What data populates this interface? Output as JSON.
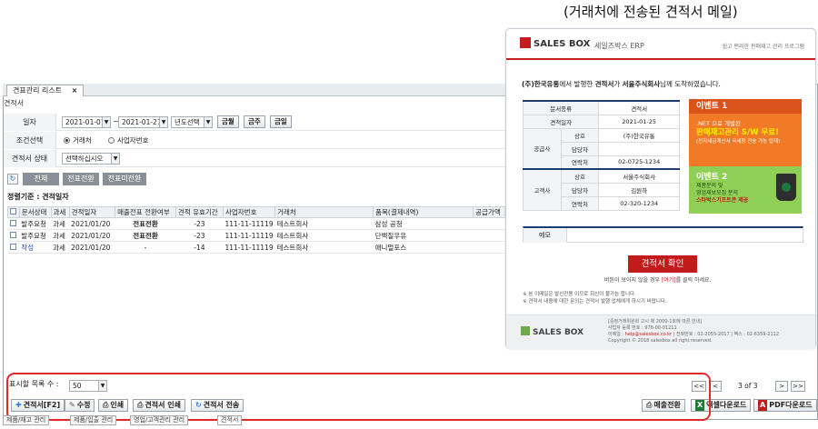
{
  "caption": "(거래처에 전송된 견적서 메일)",
  "window": {
    "tab_label": "견표관리 리스트",
    "tab_close": "×",
    "section_title": "견적서"
  },
  "form": {
    "date_label": "일자",
    "date_from": "2021-01-01",
    "date_sep": "~",
    "date_to": "2021-01-27",
    "year_select": "년도선택",
    "btn_this_month": "금월",
    "btn_this_week": "금주",
    "btn_today": "금일",
    "cond_label": "조건선택",
    "radio_partner": "거래처",
    "radio_bizno": "사업자번호",
    "status_label": "견적서 상태",
    "status_placeholder": "선택하십시오"
  },
  "filters": {
    "all": "전체",
    "converted": "전표전환",
    "not_converted": "전표미전환"
  },
  "criteria": "정렬기준 : 견적일자",
  "table": {
    "headers": [
      "문서상태",
      "과세",
      "견적일자",
      "매출전표 전환여부",
      "견적 유효기간",
      "사업자번호",
      "거래처",
      "품목(결제내역)",
      "공급가액"
    ],
    "rows": [
      {
        "status": "발주요청",
        "tax": "과세",
        "date": "2021/01/20",
        "conv": "전표전환",
        "valid": "-23",
        "bizno": "111-11-11119",
        "partner": "테스트회사",
        "items": "삼성 공청"
      },
      {
        "status": "발주요청",
        "tax": "과세",
        "date": "2021/01/20",
        "conv": "전표전환",
        "valid": "-23",
        "bizno": "111-11-11119",
        "partner": "테스트회사",
        "items": "단백질우유"
      },
      {
        "status": "작성",
        "tax": "과세",
        "date": "2021/01/20",
        "conv": "-",
        "valid": "-14",
        "bizno": "111-11-11119",
        "partner": "테스트회사",
        "items": "애니멀포스"
      }
    ]
  },
  "bottom": {
    "page_size_label": "표시할 목록 수 :",
    "page_size": "50",
    "btn_quote": "견적서[F2]",
    "btn_edit": "수정",
    "btn_print": "인쇄",
    "btn_quote_print": "견적서 인쇄",
    "btn_quote_send": "견적서 전송",
    "btn_sales_convert": "매출전환",
    "btn_excel": "엑셀다운로드",
    "btn_pdf": "PDF다운로드",
    "pager_first": "<<",
    "pager_prev": "<",
    "pager_info": "3 of 3",
    "pager_next": ">",
    "pager_last": ">>"
  },
  "bottom_tabs": [
    "제품/재고 관리",
    "제품/입출 관리",
    "영업/고객관리 관리",
    "견적서"
  ],
  "email": {
    "logo_text": "SALES BOX",
    "erp_title": "세일즈박스 ERP",
    "slogan": "쉽고 편리한 판매재고 관리 프로그램",
    "msg_sender": "(주)한국유통",
    "msg_mid1": "에서 발행한 ",
    "msg_doc": "견적서",
    "msg_mid2": "가 ",
    "msg_receiver": "서울주식회사",
    "msg_end": "님께 도착하였습니다.",
    "doc_type_label": "문서종류",
    "doc_type_value": "견적서",
    "doc_date_label": "견적일자",
    "doc_date_value": "2021-01-25",
    "supplier_label": "공급사",
    "customer_label": "고객사",
    "name_label": "상호",
    "manager_label": "담당자",
    "contact_label": "연락처",
    "supplier_name": "(주)한국유통",
    "supplier_manager": "",
    "supplier_contact": "02-0725-1234",
    "customer_name": "서울주식회사",
    "customer_manager": "김원하",
    "customer_contact": "02-320-1234",
    "event1_title": "이벤트 1",
    "event1_line1": ".NET 으로 개발된",
    "event1_line2": "판매재고관리 S/W 무료!",
    "event1_line3": "(전자세금계산서 국세청 전송 가능 탑재)",
    "event2_title": "이벤트 2",
    "event2_line1": "제품문의 및",
    "event2_line2": "영업제보모집 문의",
    "event2_line3": "스타벅스기프트콘 제공",
    "memo_label": "메모",
    "confirm_button": "견적서 확인",
    "hint_prefix": "버튼이 보이지 않을 경우 ",
    "hint_link": "[여기]",
    "hint_suffix": "를 클릭 하세요.",
    "note1": "※ 본 이메일은 발신전용 이므로 회신이 불가능 합니다.",
    "note2": "※ 견적서 내용에 대한 문의는 견적서 발행 업체에게 하시기 바랍니다.",
    "footer_logo": "SALES BOX",
    "footer_line1": "[중정거래위원회 고시 제 2000-1호에 따른 안내]",
    "footer_line2": "사업자 등록 번호 : 978-00-01211",
    "footer_line3_prefix": "이메일 : ",
    "footer_email": "help@salesbox.co.kr",
    "footer_line3_suffix": " | 전화번호 : 02-2055-2017 | 팩스 : 02-6359-2112",
    "footer_line4": "Copyright © 2018 salesbox all right reserved."
  },
  "colors": {
    "accent_red": "#c21b1b",
    "highlight_box": "#e12a2a",
    "event1": "#f07a25",
    "event2": "#8fcf55"
  }
}
